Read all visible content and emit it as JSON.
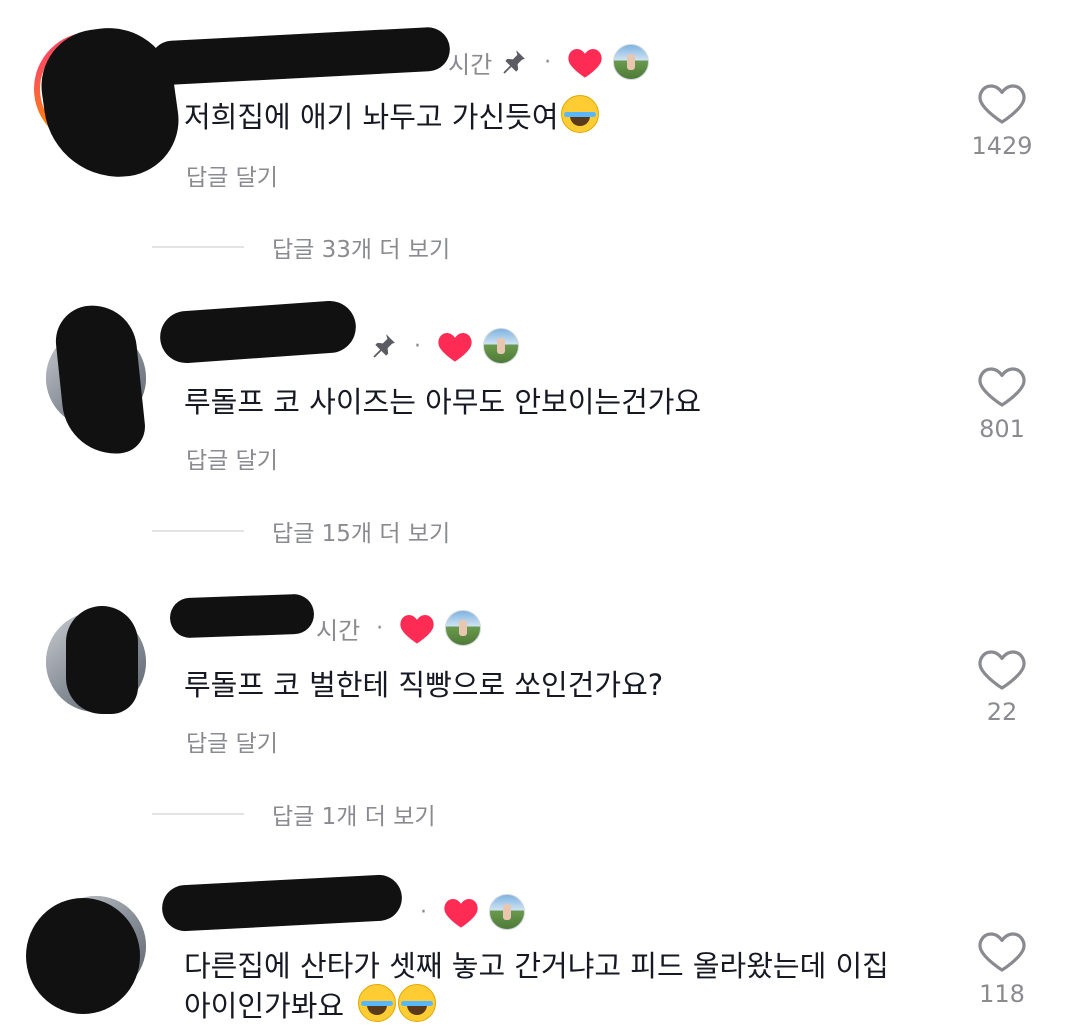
{
  "comments": [
    {
      "meta_suffix": "시간",
      "pinned": true,
      "text": "저희집에 애기 놔두고 가신듯여",
      "emojis": [
        "face-with-tears-of-joy"
      ],
      "reply_label": "답글 달기",
      "likes": "1429",
      "more_replies": "답글 33개 더 보기"
    },
    {
      "meta_suffix": "",
      "pinned": true,
      "text": "루돌프 코 사이즈는 아무도 안보이는건가요",
      "emojis": [],
      "reply_label": "답글 달기",
      "likes": "801",
      "more_replies": "답글 15개 더 보기"
    },
    {
      "meta_suffix": "시간",
      "pinned": false,
      "text": "루돌프 코 벌한테 직빵으로 쏘인건가요?",
      "emojis": [],
      "reply_label": "답글 달기",
      "likes": "22",
      "more_replies": "답글 1개 더 보기"
    },
    {
      "meta_suffix": "",
      "pinned": false,
      "text_line1": "다른집에 산타가 셋째 놓고 간거냐고 피드 올라왔는데 이집",
      "text_line2": "아이인가봐요",
      "emojis": [
        "face-with-tears-of-joy",
        "face-with-tears-of-joy"
      ],
      "likes": "118"
    }
  ],
  "colors": {
    "heart_red": "#fe2c55",
    "muted": "#8a8b91",
    "text": "#161823",
    "redaction": "#111111"
  },
  "icons": {
    "pin": "pin-icon",
    "liked_by_creator": "heart-filled-icon",
    "like": "heart-outline-icon"
  }
}
